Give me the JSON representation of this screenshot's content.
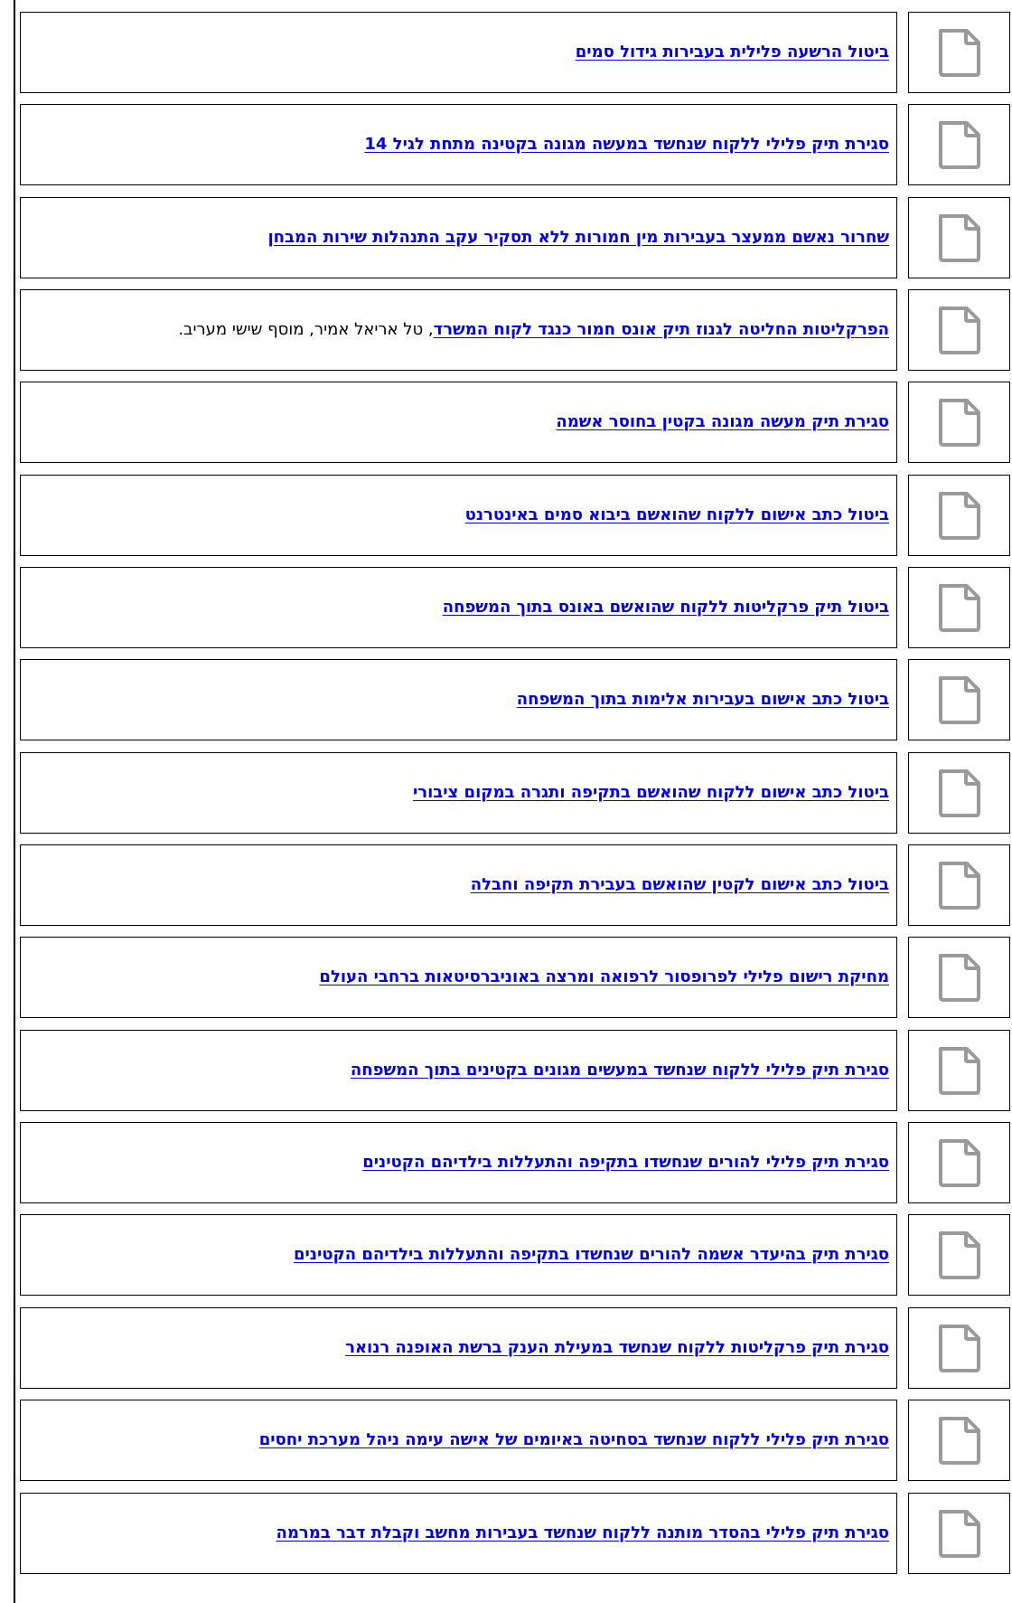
{
  "items": [
    {
      "link": "ביטול הרשעה פלילית בעבירות גידול סמים",
      "suffix": "",
      "icon": "document-icon"
    },
    {
      "link": "סגירת תיק פלילי ללקוח שנחשד במעשה מגונה בקטינה מתחת לגיל 14",
      "suffix": "",
      "icon": "document-icon"
    },
    {
      "link": "שחרור נאשם ממעצר בעבירות מין חמורות ללא תסקיר עקב התנהלות שירות המבחן",
      "suffix": "",
      "icon": "document-icon"
    },
    {
      "link": "הפרקליטות החליטה לגנוז תיק אונס חמור כנגד לקוח המשרד",
      "suffix": ", טל אריאל אמיר, מוסף שישי מעריב.",
      "icon": "document-icon"
    },
    {
      "link": "סגירת תיק מעשה מגונה בקטין בחוסר אשמה",
      "suffix": "",
      "icon": "document-icon"
    },
    {
      "link": "ביטול כתב אישום ללקוח שהואשם ביבוא סמים באינטרנט",
      "suffix": "",
      "icon": "document-icon"
    },
    {
      "link": "ביטול תיק פרקליטות ללקוח שהואשם באונס בתוך המשפחה",
      "suffix": "",
      "icon": "document-icon"
    },
    {
      "link": "ביטול כתב אישום בעבירות אלימות בתוך המשפחה",
      "suffix": "",
      "icon": "document-icon"
    },
    {
      "link": "ביטול כתב אישום ללקוח שהואשם בתקיפה ותגרה במקום ציבורי",
      "suffix": "",
      "icon": "document-icon"
    },
    {
      "link": "ביטול כתב אישום לקטין שהואשם בעבירת תקיפה וחבלה",
      "suffix": "",
      "icon": "document-icon"
    },
    {
      "link": "מחיקת רישום פלילי לפרופסור לרפואה ומרצה באוניברסיטאות ברחבי העולם",
      "suffix": "",
      "icon": "document-icon"
    },
    {
      "link": "סגירת תיק פלילי ללקוח שנחשד במעשים מגונים בקטינים בתוך המשפחה",
      "suffix": "",
      "icon": "document-icon"
    },
    {
      "link": "סגירת תיק פלילי להורים שנחשדו בתקיפה והתעללות בילדיהם הקטינים",
      "suffix": "",
      "icon": "document-icon"
    },
    {
      "link": "סגירת תיק בהיעדר אשמה להורים שנחשדו בתקיפה והתעללות בילדיהם הקטינים",
      "suffix": "",
      "icon": "document-icon"
    },
    {
      "link": "סגירת תיק פרקליטות ללקוח שנחשד במעילת הענק ברשת האופנה רנואר",
      "suffix": "",
      "icon": "document-icon"
    },
    {
      "link": "סגירת תיק פלילי ללקוח שנחשד בסחיטה באיומים של אישה עימה ניהל מערכת יחסים",
      "suffix": "",
      "icon": "document-icon"
    },
    {
      "link": "סגירת תיק פלילי בהסדר מותנה ללקוח שנחשד בעבירות מחשב וקבלת דבר במרמה",
      "suffix": "",
      "icon": "document-icon"
    }
  ]
}
